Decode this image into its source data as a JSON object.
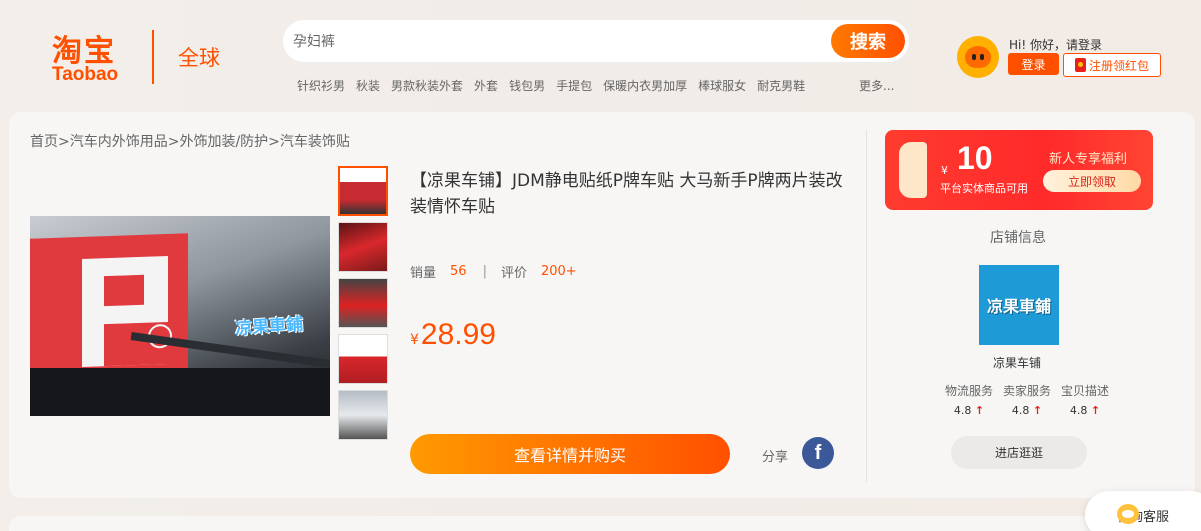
{
  "header": {
    "logo_cn": "淘宝",
    "logo_en": "Taobao",
    "logo_global": "全球",
    "search": {
      "placeholder": "孕妇裤",
      "button": "搜索"
    },
    "hot_words": [
      "针织衫男",
      "秋装",
      "男款秋装外套",
      "外套",
      "钱包男",
      "手提包",
      "保暖内衣男加厚",
      "棒球服女",
      "耐克男鞋"
    ],
    "more": "更多...",
    "user": {
      "greeting": "Hi! 你好，请登录",
      "login": "登录",
      "register": "注册领红包"
    }
  },
  "breadcrumb": "首页>汽车内外饰用品>外饰加装/防护>汽车装饰贴",
  "product": {
    "image_brand": "凉果車鋪",
    "title": "【凉果车铺】JDM静电贴纸P牌车贴 大马新手P牌两片装改装情怀车贴",
    "sales_label": "销量",
    "sales": "56",
    "review_label": "评价",
    "reviews": "200+",
    "currency": "¥",
    "price": "28.99",
    "buy_button": "查看详情并购买",
    "share": "分享",
    "facebook": "f"
  },
  "coupon": {
    "currency": "¥",
    "amount": "10",
    "subtitle": "平台实体商品可用",
    "title": "新人专享福利",
    "button": "立即领取"
  },
  "shop": {
    "section_title": "店铺信息",
    "logo_text": "凉果車鋪",
    "name": "凉果车铺",
    "ratings": [
      {
        "label": "物流服务",
        "score": "4.8",
        "arrow": "↑"
      },
      {
        "label": "卖家服务",
        "score": "4.8",
        "arrow": "↑"
      },
      {
        "label": "宝贝描述",
        "score": "4.8",
        "arrow": "↑"
      }
    ],
    "enter_store": "进店逛逛"
  },
  "service": {
    "label": "咨询客服"
  },
  "colors": {
    "accent": "#ff5000",
    "coupon": "#ff2a2a",
    "facebook": "#3b5998"
  }
}
